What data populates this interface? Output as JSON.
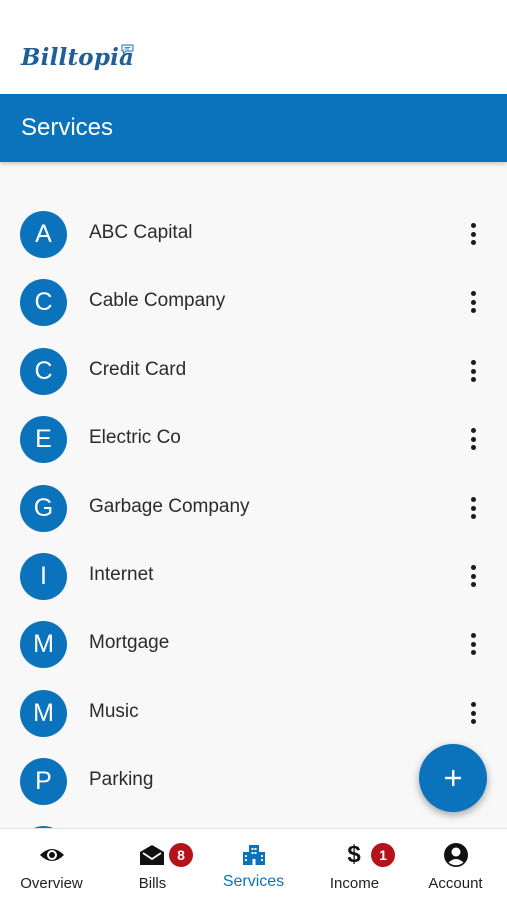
{
  "app": {
    "logo_text": "Billtopia",
    "header_title": "Services"
  },
  "colors": {
    "primary": "#0a73bb",
    "badge": "#b5121b",
    "logo": "#1f5f96"
  },
  "services": [
    {
      "letter": "A",
      "name": "ABC Capital"
    },
    {
      "letter": "C",
      "name": "Cable Company"
    },
    {
      "letter": "C",
      "name": "Credit Card"
    },
    {
      "letter": "E",
      "name": "Electric Co"
    },
    {
      "letter": "G",
      "name": "Garbage Company"
    },
    {
      "letter": "I",
      "name": "Internet"
    },
    {
      "letter": "M",
      "name": "Mortgage"
    },
    {
      "letter": "M",
      "name": "Music"
    },
    {
      "letter": "P",
      "name": "Parking"
    }
  ],
  "fab": {
    "icon": "plus-icon"
  },
  "nav": [
    {
      "label": "Overview",
      "icon": "eye-icon"
    },
    {
      "label": "Bills",
      "icon": "envelope-icon",
      "badge": "8"
    },
    {
      "label": "Services",
      "icon": "buildings-icon",
      "active": true
    },
    {
      "label": "Income",
      "icon": "dollar-icon",
      "badge": "1"
    },
    {
      "label": "Account",
      "icon": "account-icon"
    }
  ]
}
